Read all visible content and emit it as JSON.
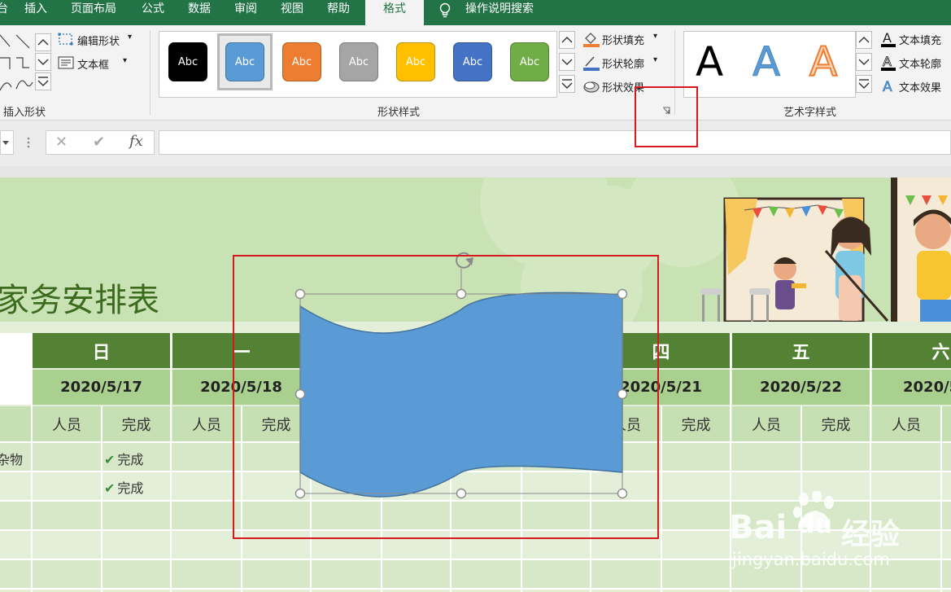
{
  "menu": {
    "tabs": [
      "插入",
      "页面布局",
      "公式",
      "数据",
      "审阅",
      "视图",
      "帮助",
      "格式"
    ],
    "edge_char": "台",
    "search": "操作说明搜索"
  },
  "ribbon": {
    "insert_shape": {
      "edit_shape": "编辑形状",
      "text_box": "文本框",
      "label": "插入形状"
    },
    "shape_styles": {
      "swatch_text": "Abc",
      "swatches": [
        "#000000",
        "#5b9bd5",
        "#ed7d31",
        "#a5a5a5",
        "#ffc000",
        "#4472c4",
        "#70ad47"
      ],
      "fill": "形状填充",
      "outline": "形状轮廓",
      "effects": "形状效果",
      "label": "形状样式"
    },
    "wordart": {
      "letters": [
        "A",
        "A",
        "A"
      ],
      "text_fill": "文本填充",
      "text_outline": "文本轮廓",
      "text_effects": "文本效果",
      "label": "艺术字样式"
    }
  },
  "formula_bar": {
    "cancel": "✕",
    "confirm": "✔",
    "fx": "fx"
  },
  "sheet": {
    "title": "家务安排表",
    "days": [
      "日",
      "一",
      "四",
      "五",
      "六"
    ],
    "dates": [
      "2020/5/17",
      "2020/5/18",
      "2020/5/21",
      "2020/5/22",
      "2020/5/"
    ],
    "sub_person": "人员",
    "sub_done": "完成",
    "row_label_partial": "杂物",
    "done_rows": [
      "完成",
      "完成"
    ]
  },
  "watermark": {
    "brand_a": "Bai",
    "brand_b": "du",
    "brand_c": "经验",
    "url": "jingyan.baidu.com"
  },
  "colors": {
    "excel_green": "#227447",
    "header_dark": "#548235",
    "header_date": "#a9d08e",
    "header_sub": "#c6e0b4",
    "shape_fill": "#5b9bd5",
    "highlight_red": "#d6181f"
  }
}
